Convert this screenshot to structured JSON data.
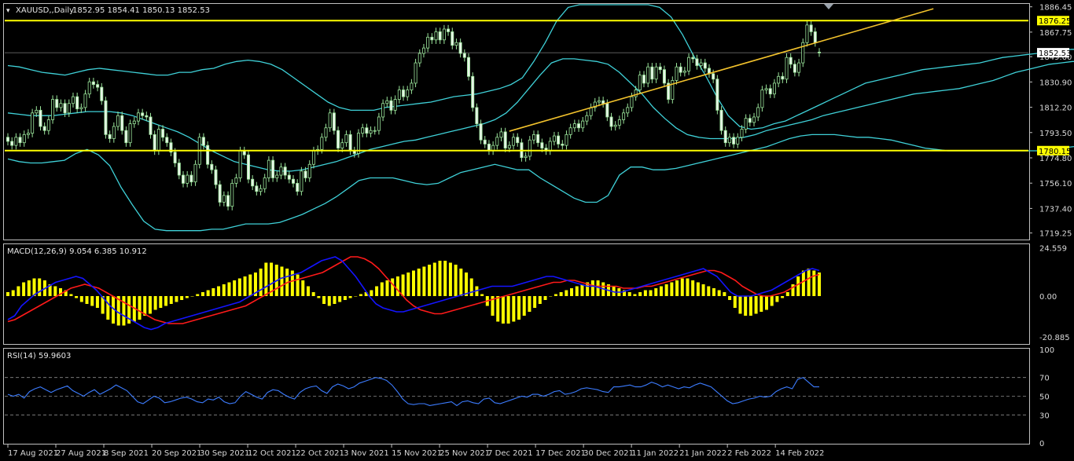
{
  "chart_data": [
    {
      "type": "candlestick",
      "title": "XAUUSD,,Daily",
      "ohlc_label": "1852.95 1854.41 1850.13 1852.53",
      "y_ticks": [
        "1886.45",
        "1867.75",
        "1849.60",
        "1830.90",
        "1812.20",
        "1793.50",
        "1774.80",
        "1756.10",
        "1737.40",
        "1719.25"
      ],
      "ylim": [
        1715,
        1888
      ],
      "price_tags": [
        "1876.25",
        "1852.53",
        "1780.15"
      ],
      "horizontal_levels": [
        1876.25,
        1780.15
      ],
      "current_price": 1852.53,
      "trendline": {
        "x": [
          123,
          227
        ],
        "y": [
          1794.5,
          1885
        ]
      },
      "x_ticks": [
        {
          "label": "17 Aug 2021",
          "index": 0
        },
        {
          "label": "27 Aug 2021",
          "index": 8
        },
        {
          "label": "8 Sep 2021",
          "index": 16
        },
        {
          "label": "20 Sep 2021",
          "index": 24
        },
        {
          "label": "30 Sep 2021",
          "index": 32
        },
        {
          "label": "12 Oct 2021",
          "index": 40
        },
        {
          "label": "22 Oct 2021",
          "index": 48
        },
        {
          "label": "3 Nov 2021",
          "index": 56
        },
        {
          "label": "15 Nov 2021",
          "index": 64
        },
        {
          "label": "25 Nov 2021",
          "index": 72
        },
        {
          "label": "7 Dec 2021",
          "index": 80
        },
        {
          "label": "17 Dec 2021",
          "index": 88
        },
        {
          "label": "30 Dec 2021",
          "index": 96
        },
        {
          "label": "11 Jan 2022",
          "index": 104
        },
        {
          "label": "21 Jan 2022",
          "index": 112
        },
        {
          "label": "2 Feb 2022",
          "index": 120
        },
        {
          "label": "14 Feb 2022",
          "index": 128
        }
      ],
      "close": [
        1787,
        1784,
        1790,
        1786,
        1792,
        1793,
        1808,
        1810,
        1798,
        1795,
        1803,
        1818,
        1812,
        1815,
        1808,
        1815,
        1820,
        1811,
        1812,
        1822,
        1831,
        1829,
        1827,
        1817,
        1792,
        1789,
        1798,
        1806,
        1795,
        1786,
        1800,
        1802,
        1808,
        1806,
        1805,
        1792,
        1780,
        1796,
        1790,
        1786,
        1779,
        1771,
        1762,
        1756,
        1762,
        1757,
        1770,
        1790,
        1784,
        1770,
        1766,
        1755,
        1742,
        1747,
        1739,
        1756,
        1760,
        1780,
        1777,
        1759,
        1754,
        1750,
        1752,
        1760,
        1773,
        1760,
        1762,
        1768,
        1762,
        1759,
        1756,
        1750,
        1765,
        1760,
        1770,
        1780,
        1781,
        1790,
        1797,
        1808,
        1795,
        1782,
        1786,
        1792,
        1780,
        1778,
        1793,
        1797,
        1793,
        1795,
        1795,
        1805,
        1815,
        1817,
        1810,
        1818,
        1825,
        1820,
        1825,
        1830,
        1845,
        1852,
        1856,
        1864,
        1862,
        1868,
        1862,
        1870,
        1868,
        1858,
        1860,
        1852,
        1849,
        1835,
        1812,
        1800,
        1788,
        1785,
        1780,
        1784,
        1790,
        1794,
        1782,
        1784,
        1790,
        1786,
        1775,
        1776,
        1788,
        1792,
        1786,
        1782,
        1780,
        1787,
        1791,
        1785,
        1784,
        1792,
        1797,
        1800,
        1797,
        1802,
        1806,
        1812,
        1816,
        1817,
        1815,
        1805,
        1798,
        1799,
        1803,
        1808,
        1812,
        1820,
        1825,
        1836,
        1830,
        1842,
        1833,
        1842,
        1840,
        1830,
        1818,
        1832,
        1842,
        1838,
        1839,
        1849,
        1848,
        1843,
        1845,
        1841,
        1837,
        1833,
        1810,
        1795,
        1786,
        1790,
        1785,
        1790,
        1796,
        1804,
        1801,
        1805,
        1812,
        1825,
        1826,
        1822,
        1830,
        1835,
        1833,
        1849,
        1844,
        1838,
        1845,
        1860,
        1873,
        1868,
        1860,
        1852.5
      ],
      "open": [
        1790,
        1787,
        1784,
        1790,
        1786,
        1792,
        1793,
        1808,
        1810,
        1798,
        1795,
        1803,
        1818,
        1812,
        1815,
        1808,
        1815,
        1820,
        1811,
        1812,
        1822,
        1831,
        1829,
        1827,
        1817,
        1792,
        1789,
        1798,
        1806,
        1795,
        1786,
        1800,
        1802,
        1808,
        1806,
        1805,
        1792,
        1780,
        1796,
        1790,
        1786,
        1779,
        1771,
        1762,
        1756,
        1762,
        1757,
        1770,
        1790,
        1784,
        1770,
        1766,
        1755,
        1742,
        1747,
        1739,
        1756,
        1760,
        1780,
        1777,
        1759,
        1754,
        1750,
        1752,
        1760,
        1773,
        1760,
        1762,
        1768,
        1762,
        1759,
        1756,
        1750,
        1765,
        1760,
        1770,
        1780,
        1781,
        1790,
        1797,
        1808,
        1795,
        1782,
        1786,
        1792,
        1780,
        1778,
        1793,
        1797,
        1793,
        1795,
        1795,
        1805,
        1815,
        1817,
        1810,
        1818,
        1825,
        1820,
        1825,
        1830,
        1845,
        1852,
        1856,
        1864,
        1862,
        1868,
        1862,
        1870,
        1868,
        1858,
        1860,
        1852,
        1849,
        1835,
        1812,
        1800,
        1788,
        1785,
        1780,
        1784,
        1790,
        1794,
        1782,
        1784,
        1790,
        1786,
        1775,
        1776,
        1788,
        1792,
        1786,
        1782,
        1780,
        1787,
        1791,
        1785,
        1784,
        1792,
        1797,
        1800,
        1797,
        1802,
        1806,
        1812,
        1816,
        1817,
        1815,
        1805,
        1798,
        1799,
        1803,
        1808,
        1812,
        1820,
        1825,
        1836,
        1830,
        1842,
        1833,
        1842,
        1840,
        1830,
        1818,
        1832,
        1842,
        1838,
        1839,
        1849,
        1848,
        1843,
        1845,
        1841,
        1837,
        1833,
        1810,
        1795,
        1786,
        1790,
        1785,
        1790,
        1796,
        1804,
        1801,
        1805,
        1812,
        1825,
        1826,
        1822,
        1830,
        1835,
        1833,
        1849,
        1844,
        1838,
        1845,
        1860,
        1873,
        1868,
        1852.95
      ],
      "bb_upper": [
        1843,
        1842,
        1840,
        1838,
        1837,
        1836,
        1838,
        1840,
        1841,
        1840,
        1839,
        1838,
        1837,
        1836,
        1836,
        1838,
        1838,
        1840,
        1841,
        1844,
        1846,
        1847,
        1846,
        1844,
        1840,
        1834,
        1828,
        1822,
        1816,
        1812,
        1810,
        1810,
        1810,
        1812,
        1813,
        1814,
        1815,
        1816,
        1818,
        1820,
        1821,
        1822,
        1824,
        1826,
        1829,
        1834,
        1846,
        1860,
        1876,
        1886,
        1888,
        1888,
        1888,
        1888,
        1888,
        1888,
        1888,
        1886,
        1879,
        1866,
        1850,
        1836,
        1820,
        1806,
        1798,
        1796,
        1797,
        1800,
        1802,
        1806,
        1810,
        1814,
        1818,
        1822,
        1826,
        1830,
        1832,
        1834,
        1836,
        1838,
        1840,
        1841,
        1842,
        1843,
        1844,
        1845,
        1847,
        1849,
        1850,
        1851,
        1852,
        1853,
        1854,
        1855,
        1855,
        1855,
        1855,
        1855,
        1855,
        1855,
        1856,
        1858,
        1862,
        1870,
        1876
      ],
      "bb_mid": [
        1808,
        1807,
        1806,
        1806,
        1806,
        1807,
        1808,
        1809,
        1809,
        1809,
        1808,
        1806,
        1803,
        1800,
        1797,
        1794,
        1790,
        1785,
        1780,
        1776,
        1772,
        1770,
        1768,
        1766,
        1765,
        1765,
        1766,
        1768,
        1770,
        1772,
        1775,
        1778,
        1781,
        1783,
        1785,
        1787,
        1788,
        1790,
        1792,
        1794,
        1796,
        1798,
        1800,
        1803,
        1808,
        1816,
        1826,
        1836,
        1845,
        1848,
        1848,
        1847,
        1846,
        1844,
        1838,
        1830,
        1822,
        1812,
        1804,
        1797,
        1792,
        1790,
        1789,
        1789,
        1789,
        1790,
        1792,
        1795,
        1797,
        1799,
        1801,
        1803,
        1806,
        1808,
        1810,
        1812,
        1814,
        1816,
        1818,
        1820,
        1822,
        1823,
        1824,
        1825,
        1826,
        1828,
        1830,
        1832,
        1835,
        1838,
        1840,
        1842,
        1844,
        1845,
        1846,
        1846,
        1846,
        1846,
        1845,
        1832,
        1825,
        1823,
        1823,
        1824,
        1828,
        1830
      ],
      "bb_lower": [
        1774,
        1772,
        1771,
        1771,
        1772,
        1773,
        1778,
        1781,
        1777,
        1769,
        1753,
        1740,
        1728,
        1722,
        1721,
        1721,
        1721,
        1721,
        1722,
        1722,
        1724,
        1726,
        1726,
        1726,
        1727,
        1730,
        1733,
        1737,
        1741,
        1746,
        1752,
        1758,
        1760,
        1760,
        1760,
        1758,
        1756,
        1755,
        1756,
        1760,
        1764,
        1766,
        1768,
        1770,
        1768,
        1766,
        1766,
        1760,
        1755,
        1750,
        1745,
        1742,
        1742,
        1747,
        1762,
        1768,
        1768,
        1766,
        1766,
        1767,
        1769,
        1771,
        1773,
        1775,
        1777,
        1779,
        1781,
        1783,
        1786,
        1789,
        1791,
        1792,
        1792,
        1792,
        1791,
        1790,
        1790,
        1789,
        1788,
        1786,
        1784,
        1782,
        1781,
        1780,
        1780,
        1780,
        1780,
        1780,
        1780,
        1780,
        1780,
        1780,
        1781,
        1782,
        1783,
        1784,
        1784,
        1783,
        1782,
        1781,
        1780,
        1780,
        1780,
        1780,
        1780,
        1780
      ]
    },
    {
      "type": "bar+line",
      "title": "MACD(12,26,9) 9.054 6.385 10.912",
      "y_ticks": [
        "24.559",
        "0.00",
        "-20.885"
      ],
      "ylim": [
        -24,
        26
      ],
      "series": [
        {
          "name": "MACD",
          "color": "#ffff00"
        },
        {
          "name": "signal_blue",
          "color": "#1414ff"
        },
        {
          "name": "signal_red",
          "color": "#ff1a1a"
        }
      ],
      "histogram": [
        2,
        3,
        5,
        7,
        8,
        9,
        9,
        8,
        6,
        5,
        4,
        3,
        1,
        -1,
        -3,
        -4,
        -5,
        -6,
        -9,
        -12,
        -14,
        -15,
        -15,
        -14,
        -13,
        -12,
        -10,
        -9,
        -7,
        -6,
        -5,
        -4,
        -3,
        -2,
        -1,
        0,
        1,
        2,
        3,
        4,
        5,
        6,
        7,
        8,
        9,
        10,
        11,
        12,
        14,
        17,
        17,
        16,
        15,
        14,
        13,
        11,
        8,
        5,
        2,
        -1,
        -4,
        -5,
        -4,
        -3,
        -2,
        -1,
        0,
        1,
        2,
        3,
        5,
        7,
        8,
        9,
        10,
        11,
        12,
        13,
        14,
        15,
        16,
        17,
        18,
        18,
        17,
        16,
        14,
        12,
        9,
        5,
        1,
        -5,
        -10,
        -13,
        -14,
        -14,
        -13,
        -12,
        -10,
        -8,
        -6,
        -4,
        -2,
        0,
        1,
        2,
        3,
        4,
        5,
        6,
        7,
        8,
        8,
        7,
        6,
        5,
        4,
        3,
        2,
        1,
        2,
        3,
        3,
        4,
        5,
        6,
        7,
        8,
        9,
        9,
        8,
        7,
        6,
        5,
        4,
        3,
        2,
        -2,
        -6,
        -9,
        -10,
        -10,
        -9,
        -8,
        -7,
        -5,
        -3,
        -1,
        2,
        6,
        10,
        13,
        14,
        13,
        12
      ],
      "blue": [
        -12,
        -10,
        -5,
        -2,
        1,
        3,
        5,
        7,
        8,
        9,
        10,
        9,
        6,
        3,
        -1,
        -5,
        -8,
        -10,
        -12,
        -14,
        -16,
        -17,
        -16,
        -14,
        -13,
        -12,
        -11,
        -10,
        -9,
        -8,
        -7,
        -6,
        -5,
        -4,
        -3,
        -1,
        1,
        3,
        5,
        7,
        9,
        10,
        11,
        12,
        14,
        16,
        18,
        19,
        20,
        18,
        14,
        10,
        5,
        0,
        -4,
        -6,
        -7,
        -8,
        -8,
        -7,
        -6,
        -5,
        -4,
        -3,
        -2,
        -1,
        0,
        1,
        2,
        3,
        4,
        5,
        5,
        5,
        5,
        6,
        7,
        8,
        9,
        10,
        10,
        9,
        8,
        7,
        6,
        5,
        5,
        4,
        3,
        2,
        2,
        3,
        4,
        5,
        6,
        7,
        8,
        9,
        10,
        11,
        12,
        13,
        14,
        12,
        10,
        6,
        2,
        0,
        0,
        0,
        1,
        2,
        3,
        5,
        7,
        9,
        11,
        13,
        14,
        13
      ],
      "red": [
        -13,
        -12,
        -10,
        -8,
        -6,
        -4,
        -2,
        0,
        2,
        4,
        5,
        6,
        5,
        4,
        2,
        0,
        -2,
        -4,
        -6,
        -8,
        -10,
        -12,
        -13,
        -14,
        -14,
        -14,
        -13,
        -12,
        -11,
        -10,
        -9,
        -8,
        -7,
        -6,
        -5,
        -3,
        -1,
        1,
        3,
        5,
        7,
        8,
        9,
        10,
        11,
        12,
        14,
        16,
        18,
        20,
        20,
        19,
        17,
        14,
        10,
        6,
        2,
        -2,
        -5,
        -7,
        -8,
        -9,
        -9,
        -8,
        -7,
        -6,
        -5,
        -4,
        -3,
        -2,
        -1,
        0,
        1,
        2,
        3,
        4,
        5,
        6,
        7,
        7,
        8,
        8,
        7,
        6,
        5,
        5,
        5,
        5,
        4,
        4,
        4,
        5,
        5,
        6,
        7,
        8,
        9,
        10,
        11,
        12,
        13,
        13,
        12,
        10,
        8,
        5,
        3,
        1,
        0,
        0,
        1,
        2,
        4,
        6,
        8,
        10,
        11
      ]
    },
    {
      "type": "line",
      "title": "RSI(14) 59.9603",
      "y_ticks": [
        "100",
        "70",
        "50",
        "30",
        "0"
      ],
      "ylim": [
        0,
        100
      ],
      "levels": [
        70,
        50,
        30
      ],
      "series": [
        {
          "name": "RSI(14)",
          "color": "#3c7cff"
        }
      ],
      "values": [
        52,
        50,
        52,
        48,
        55,
        58,
        60,
        57,
        54,
        57,
        59,
        61,
        56,
        53,
        50,
        54,
        57,
        52,
        55,
        58,
        62,
        59,
        56,
        50,
        44,
        42,
        46,
        50,
        48,
        43,
        44,
        46,
        48,
        49,
        47,
        44,
        43,
        47,
        46,
        49,
        44,
        42,
        43,
        50,
        55,
        52,
        49,
        47,
        54,
        57,
        56,
        52,
        49,
        47,
        54,
        58,
        60,
        61,
        56,
        53,
        60,
        63,
        61,
        58,
        60,
        64,
        66,
        68,
        70,
        69,
        67,
        62,
        55,
        47,
        42,
        41,
        42,
        42,
        40,
        41,
        42,
        43,
        44,
        40,
        44,
        45,
        43,
        42,
        47,
        48,
        43,
        42,
        44,
        46,
        48,
        50,
        49,
        52,
        52,
        50,
        52,
        55,
        56,
        52,
        53,
        55,
        58,
        59,
        58,
        57,
        55,
        54,
        60,
        60,
        61,
        62,
        60,
        60,
        62,
        65,
        63,
        60,
        62,
        60,
        58,
        60,
        59,
        62,
        64,
        62,
        60,
        55,
        50,
        45,
        42,
        43,
        45,
        47,
        48,
        50,
        49,
        50,
        55,
        58,
        60,
        58,
        68,
        70,
        65,
        60,
        60
      ]
    }
  ]
}
